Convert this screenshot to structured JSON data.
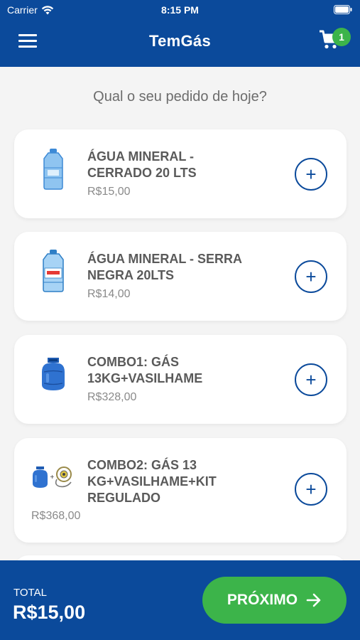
{
  "status": {
    "carrier": "Carrier",
    "time": "8:15 PM"
  },
  "header": {
    "title": "TemGás",
    "cart_count": "1"
  },
  "main": {
    "subtitle": "Qual o seu pedido de hoje?"
  },
  "products": [
    {
      "name": "ÁGUA MINERAL - CERRADO 20 LTS",
      "price": "R$15,00",
      "icon": "water-jug-icon"
    },
    {
      "name": "ÁGUA MINERAL - SERRA NEGRA 20LTS",
      "price": "R$14,00",
      "icon": "water-jug-icon"
    },
    {
      "name": "COMBO1: GÁS 13KG+VASILHAME",
      "price": "R$328,00",
      "icon": "gas-cylinder-icon"
    },
    {
      "name": "COMBO2: GÁS 13 KG+VASILHAME+KIT REGULADO",
      "price": "R$368,00",
      "icon": "gas-regulator-kit-icon"
    }
  ],
  "footer": {
    "total_label": "TOTAL",
    "total_value": "R$15,00",
    "next_label": "PRÓXIMO"
  },
  "colors": {
    "primary": "#0b4a9b",
    "accent": "#3cb44a",
    "background": "#f4f4f4"
  }
}
